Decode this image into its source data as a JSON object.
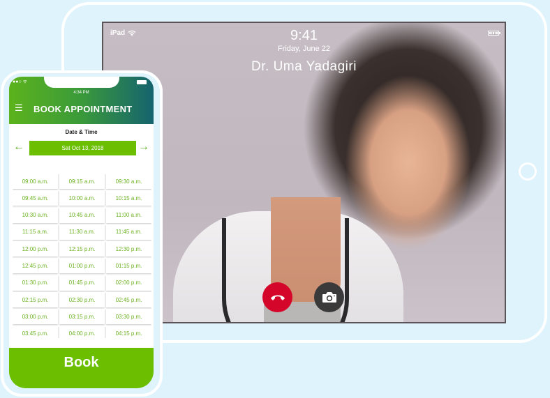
{
  "tablet": {
    "status": {
      "device_label": "iPad",
      "wifi_icon": "wifi-icon",
      "battery_icon": "battery-icon"
    },
    "lock_time": "9:41",
    "lock_date": "Friday, June 22",
    "caller_name": "Dr. Uma Yadagiri",
    "actions": [
      {
        "name": "end-call",
        "icon": "phone-hangup-icon",
        "color": "#d4062a"
      },
      {
        "name": "camera",
        "icon": "camera-icon",
        "color": "#3b3a3b"
      }
    ]
  },
  "phone": {
    "status_time": "4:34 PM",
    "header": {
      "menu_icon": "hamburger-icon",
      "title": "BOOK APPOINTMENT"
    },
    "date_time_label": "Date & Time",
    "selected_date": "Sat Oct 13, 2018",
    "prev_icon": "arrow-left-icon",
    "next_icon": "arrow-right-icon",
    "slots": [
      "09:00 a.m.",
      "09:15 a.m.",
      "09:30 a.m.",
      "09:45 a.m.",
      "10:00 a.m.",
      "10:15 a.m.",
      "10:30 a.m.",
      "10:45 a.m.",
      "11:00 a.m.",
      "11:15 a.m.",
      "11:30 a.m.",
      "11:45 a.m.",
      "12:00 p.m.",
      "12:15 p.m.",
      "12:30 p.m.",
      "12:45 p.m.",
      "01:00 p.m.",
      "01:15 p.m.",
      "01:30 p.m.",
      "01:45 p.m.",
      "02:00 p.m.",
      "02:15 p.m.",
      "02:30 p.m.",
      "02:45 p.m.",
      "03:00 p.m.",
      "03:15 p.m.",
      "03:30 p.m.",
      "03:45 p.m.",
      "04:00 p.m.",
      "04:15 p.m."
    ],
    "book_label": "Book"
  },
  "colors": {
    "accent_green": "#6bbf00",
    "slot_text": "#6bb120",
    "background": "#dff3fd"
  }
}
